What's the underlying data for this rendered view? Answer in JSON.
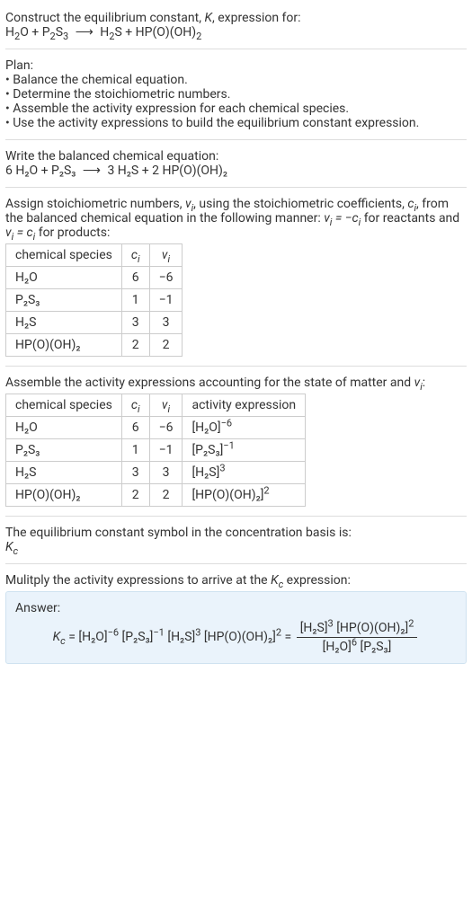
{
  "intro": {
    "line1_a": "Construct the equilibrium constant, ",
    "line1_b": ", expression for:"
  },
  "eq1": {
    "r1": "H",
    "r1s": "2",
    "r1b": "O + P",
    "r1s2": "2",
    "r1c": "S",
    "r1s3": "3",
    "arrow": "⟶",
    "p1": "H",
    "p1s": "2",
    "p1b": "S + HP(O)(OH)",
    "p1s2": "2"
  },
  "plan": {
    "title": "Plan:",
    "b1": "• Balance the chemical equation.",
    "b2": "• Determine the stoichiometric numbers.",
    "b3": "• Assemble the activity expression for each chemical species.",
    "b4": "• Use the activity expressions to build the equilibrium constant expression."
  },
  "balanced": {
    "title": "Write the balanced chemical equation:",
    "r": "6 H₂O + P₂S₃",
    "arrow": "⟶",
    "p": "3 H₂S + 2 HP(O)(OH)₂"
  },
  "assign": {
    "line_a": "Assign stoichiometric numbers, ",
    "line_b": ", using the stoichiometric coefficients, ",
    "line_c": ", from the balanced chemical equation in the following manner: ",
    "line_d": " for reactants and ",
    "line_e": " for products:"
  },
  "table1": {
    "h1": "chemical species",
    "rows": [
      {
        "species": "H₂O",
        "c": "6",
        "v": "−6"
      },
      {
        "species": "P₂S₃",
        "c": "1",
        "v": "−1"
      },
      {
        "species": "H₂S",
        "c": "3",
        "v": "3"
      },
      {
        "species": "HP(O)(OH)₂",
        "c": "2",
        "v": "2"
      }
    ]
  },
  "assemble": {
    "line_a": "Assemble the activity expressions accounting for the state of matter and ",
    "line_b": ":"
  },
  "table2": {
    "h1": "chemical species",
    "h4": "activity expression",
    "rows": [
      {
        "species": "H₂O",
        "c": "6",
        "v": "−6",
        "base": "[H₂O]",
        "exp": "−6"
      },
      {
        "species": "P₂S₃",
        "c": "1",
        "v": "−1",
        "base": "[P₂S₃]",
        "exp": "−1"
      },
      {
        "species": "H₂S",
        "c": "3",
        "v": "3",
        "base": "[H₂S]",
        "exp": "3"
      },
      {
        "species": "HP(O)(OH)₂",
        "c": "2",
        "v": "2",
        "base": "[HP(O)(OH)₂]",
        "exp": "2"
      }
    ]
  },
  "symbol": {
    "line": "The equilibrium constant symbol in the concentration basis is:"
  },
  "multiply": {
    "line_a": "Mulitply the activity expressions to arrive at the ",
    "line_b": " expression:"
  },
  "answer": {
    "label": "Answer:",
    "terms": {
      "t1": "[H₂O]",
      "e1": "−6",
      "t2": "[P₂S₃]",
      "e2": "−1",
      "t3": "[H₂S]",
      "e3": "3",
      "t4": "[HP(O)(OH)₂]",
      "e4": "2"
    },
    "frac": {
      "n1": "[H₂S]",
      "ne1": "3",
      "n2": "[HP(O)(OH)₂]",
      "ne2": "2",
      "d1": "[H₂O]",
      "de1": "6",
      "d2": "[P₂S₃]"
    }
  }
}
